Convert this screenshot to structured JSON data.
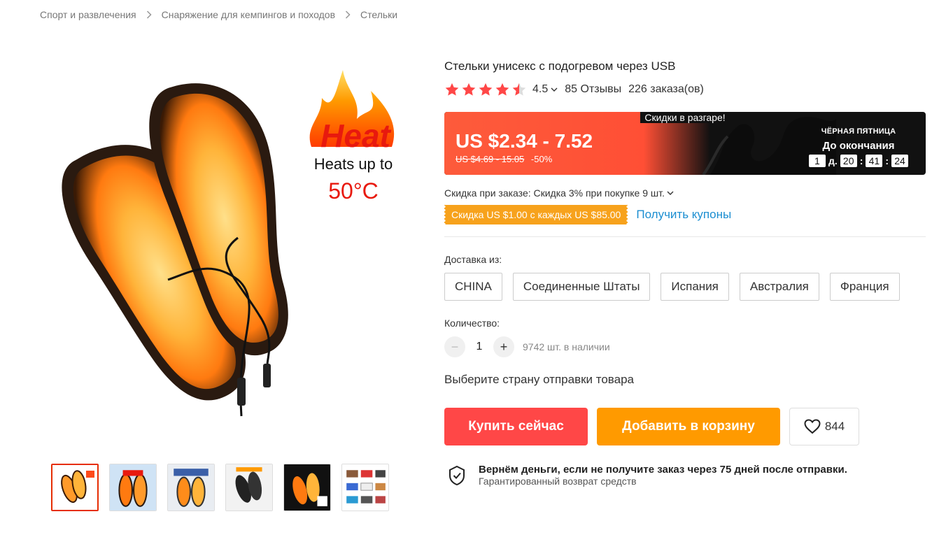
{
  "breadcrumb": [
    "Спорт и развлечения",
    "Снаряжение для кемпингов и походов",
    "Стельки"
  ],
  "product": {
    "title": "Стельки унисекс с подогревом через USB",
    "rating": "4.5",
    "rating_value": 4.5,
    "reviews": "85 Отзывы",
    "orders": "226 заказа(ов)",
    "image_text": {
      "heat": "Heat",
      "line1": "Heats up to",
      "line2": "50°C"
    },
    "thumbnail_count": 6
  },
  "promo": {
    "banner": "Скидки в разгаре!",
    "price": "US $2.34 - 7.52",
    "old_price": "US $4.69 - 15.05",
    "discount": "-50%",
    "event": "ЧЁРНАЯ ПЯТНИЦА",
    "until_end": "До окончания",
    "timer": {
      "days": "1",
      "days_unit": "д.",
      "hours": "20",
      "minutes": "41",
      "seconds": "24"
    }
  },
  "discount_line": "Скидка при заказе: Скидка 3% при покупке 9 шт.",
  "coupon": {
    "text": "Скидка US $1.00 с каждых US $85.00",
    "link": "Получить купоны"
  },
  "shipping": {
    "label": "Доставка из:",
    "options": [
      "CHINA",
      "Соединенные Штаты",
      "Испания",
      "Австралия",
      "Франция"
    ]
  },
  "quantity": {
    "label": "Количество:",
    "minus": "−",
    "value": "1",
    "plus": "+",
    "stock": "9742 шт. в наличии"
  },
  "select_country": "Выберите страну отправки товара",
  "actions": {
    "buy": "Купить сейчас",
    "cart": "Добавить в корзину",
    "wishlist_count": "844"
  },
  "guarantee": {
    "title": "Вернём деньги, если не получите заказ через 75 дней после отправки.",
    "subtitle": "Гарантированный возврат средств"
  },
  "colors": {
    "accent_red": "#ff4747",
    "accent_orange": "#ff9a00",
    "coupon": "#f7a21c",
    "link": "#1b8ed1",
    "star": "#ff4747"
  }
}
